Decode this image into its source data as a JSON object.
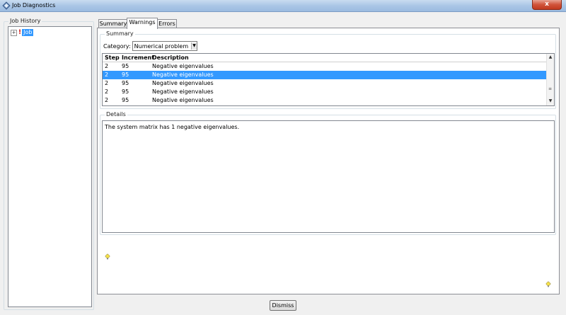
{
  "window": {
    "title": "Job Diagnostics",
    "close_symbol": "x"
  },
  "job_history": {
    "label": "Job History",
    "items": [
      {
        "label": "Job",
        "expander": "+",
        "warning_mark": "!"
      }
    ]
  },
  "tabs": [
    {
      "label": "Summary",
      "active": false
    },
    {
      "label": "Warnings",
      "active": true
    },
    {
      "label": "Errors",
      "active": false
    }
  ],
  "summary": {
    "label": "Summary",
    "category_label": "Category:",
    "category_value": "Numerical problem",
    "columns": [
      "Step",
      "Increment",
      "Description"
    ],
    "rows": [
      [
        "2",
        "95",
        "Negative eigenvalues"
      ],
      [
        "2",
        "95",
        "Negative eigenvalues"
      ],
      [
        "2",
        "95",
        "Negative eigenvalues"
      ],
      [
        "2",
        "95",
        "Negative eigenvalues"
      ],
      [
        "2",
        "95",
        "Negative eigenvalues"
      ]
    ],
    "selected_row": 1
  },
  "details": {
    "label": "Details",
    "text": "The system matrix has 1 negative eigenvalues."
  },
  "buttons": {
    "dismiss": "Dismiss"
  },
  "colors": {
    "selection": "#3399ff",
    "warning": "#d01010"
  }
}
